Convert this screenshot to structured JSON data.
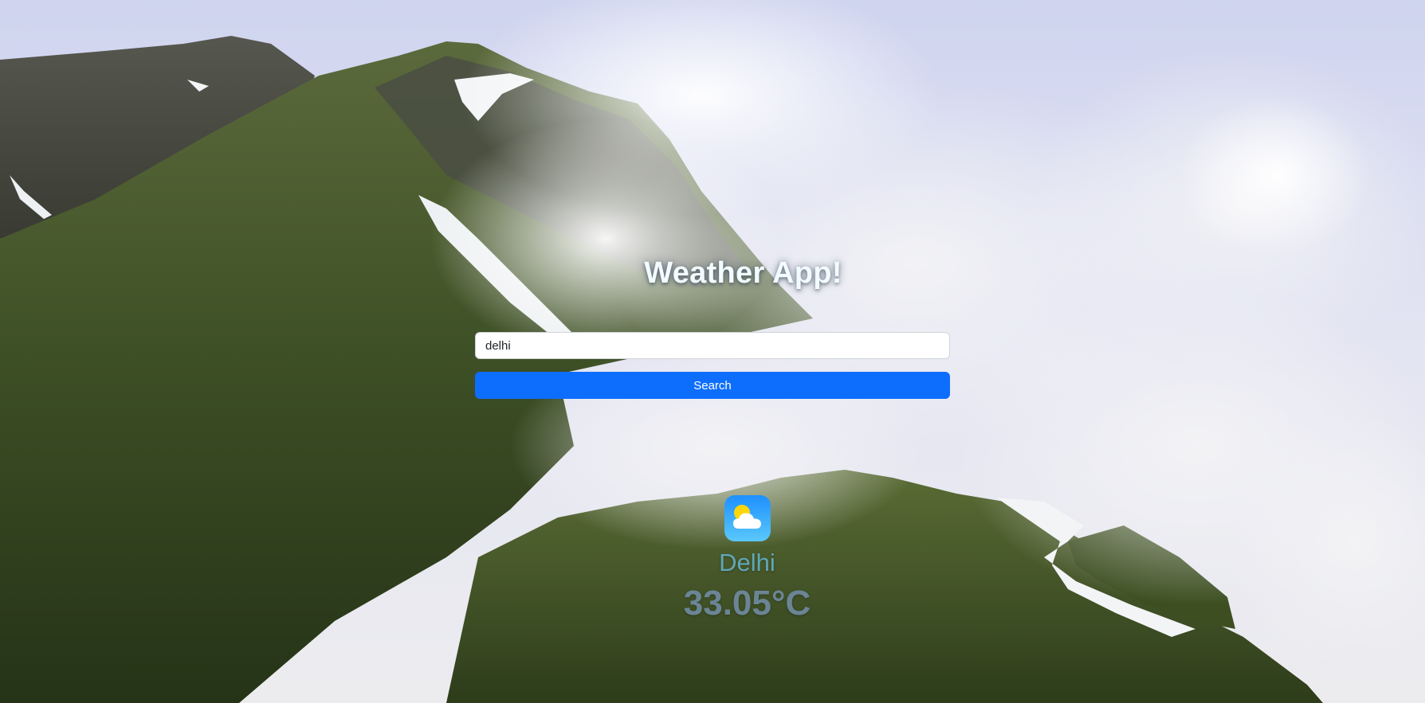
{
  "app": {
    "title": "Weather App!"
  },
  "search": {
    "value": "delhi",
    "button_label": "Search"
  },
  "weather": {
    "icon": "partly-cloudy-icon",
    "city": "Delhi",
    "temperature": "33.05°C"
  },
  "colors": {
    "button": "#0d6efd",
    "city_text": "#5fa7b7",
    "temp_text": "#6b8596"
  }
}
